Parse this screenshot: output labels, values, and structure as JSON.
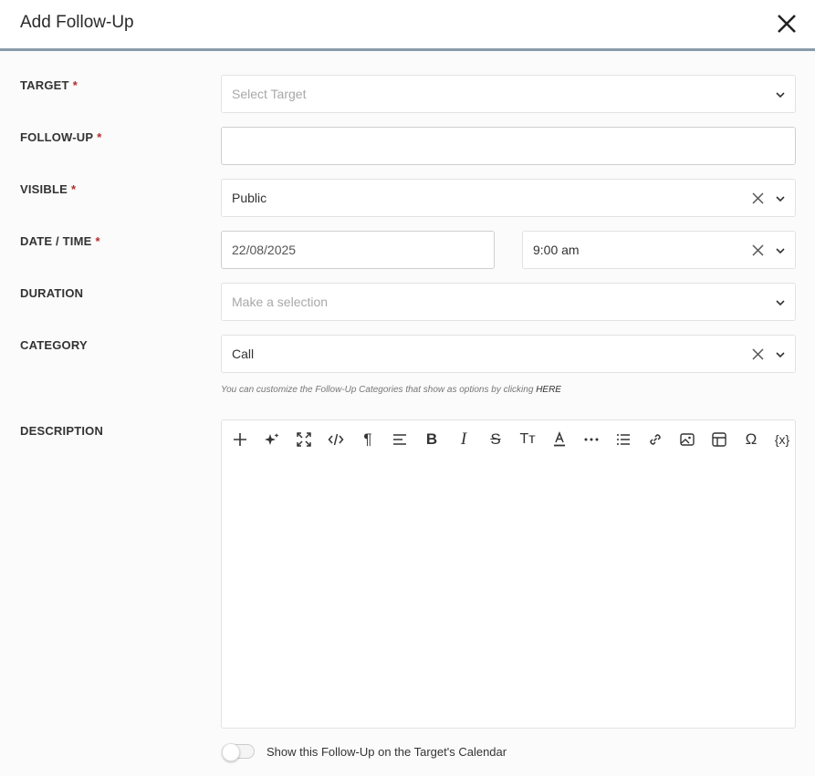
{
  "dialog": {
    "title": "Add Follow-Up",
    "close_icon": "close-icon"
  },
  "form": {
    "target": {
      "label": "TARGET",
      "required": "*",
      "placeholder": "Select Target",
      "icon": "chevron-down-icon"
    },
    "follow_up": {
      "label": "FOLLOW-UP",
      "required": "*",
      "value": ""
    },
    "visible": {
      "label": "VISIBLE",
      "required": "*",
      "value": "Public"
    },
    "date_time": {
      "label": "DATE / TIME",
      "required": "*",
      "date": "22/08/2025",
      "time": "9:00 am"
    },
    "duration": {
      "label": "DURATION",
      "placeholder": "Make a selection"
    },
    "category": {
      "label": "CATEGORY",
      "value": "Call",
      "hint_text": "You can customize the Follow-Up Categories that show as options by clicking",
      "hint_link": "HERE"
    },
    "description": {
      "label": "DESCRIPTION",
      "toolbar": [
        "plus-icon",
        "ai-sparkle-icon",
        "fullscreen-icon",
        "code-view-icon",
        "paragraph-icon",
        "align-icon",
        "bold-icon",
        "italic-icon",
        "strikethrough-icon",
        "font-size-icon",
        "text-color-icon",
        "more-icon",
        "list-icon",
        "link-icon",
        "image-icon",
        "table-icon",
        "special-char-icon",
        "variable-icon"
      ],
      "toolbar_glyphs": {
        "strikethrough": "S",
        "font_size": "Tт",
        "omega": "Ω",
        "variable": "{x}",
        "paragraph": "¶"
      }
    },
    "calendar_toggle": {
      "label": "Show this Follow-Up on the Target's Calendar",
      "on": false
    }
  }
}
